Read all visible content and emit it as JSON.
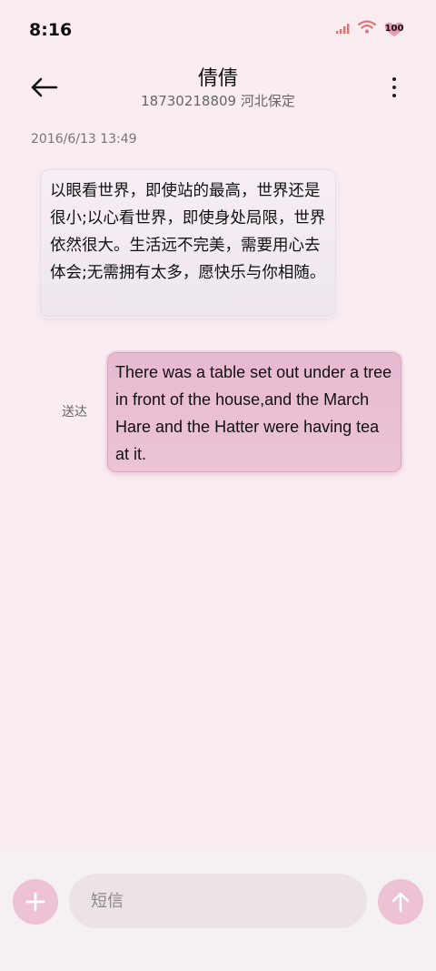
{
  "status_bar": {
    "time": "8:16",
    "battery": "100"
  },
  "header": {
    "contact_name": "倩倩",
    "contact_subtitle": "18730218809 河北保定"
  },
  "conversation": {
    "timestamp": "2016/6/13 13:49",
    "incoming": {
      "text": "以眼看世界，即使站的最高，世界还是很小;以心看世界，即使身处局限，世界依然很大。生活远不完美，需要用心去体会;无需拥有太多，愿快乐与你相随。"
    },
    "outgoing": {
      "status": "送达",
      "text": "There was a table set out under a tree in front of the house,and the March Hare and the Hatter were having tea at it."
    }
  },
  "composer": {
    "placeholder": "短信"
  },
  "colors": {
    "background": "#f9edf1",
    "accent": "#ecc2d4",
    "outgoing_bubble": "#e8b9d0"
  },
  "icons": [
    "signal-icon",
    "wifi-icon",
    "battery-icon",
    "back-arrow-icon",
    "more-vert-icon",
    "plus-icon",
    "send-arrow-icon"
  ]
}
